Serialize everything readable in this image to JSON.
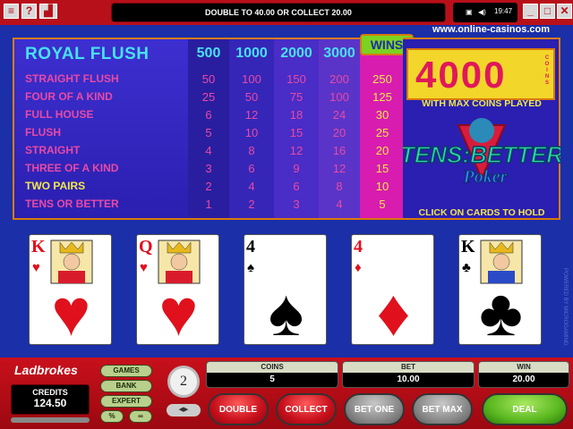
{
  "topbar": {
    "message": "DOUBLE TO 40.00 OR COLLECT 20.00",
    "clock": "19:47",
    "left_icons": [
      "menu-icon",
      "help-icon",
      "stats-icon"
    ],
    "right_icons": [
      "minimize-icon",
      "restore-icon",
      "close-icon"
    ]
  },
  "site": "www.online-casinos.com",
  "paytable": {
    "royal_label": "ROYAL FLUSH",
    "columns": [
      "500",
      "1000",
      "2000",
      "3000"
    ],
    "wins_label": "WINS",
    "rows": [
      {
        "hand": "STRAIGHT FLUSH",
        "values": [
          "50",
          "100",
          "150",
          "200",
          "250"
        ]
      },
      {
        "hand": "FOUR OF A KIND",
        "values": [
          "25",
          "50",
          "75",
          "100",
          "125"
        ]
      },
      {
        "hand": "FULL HOUSE",
        "values": [
          "6",
          "12",
          "18",
          "24",
          "30"
        ]
      },
      {
        "hand": "FLUSH",
        "values": [
          "5",
          "10",
          "15",
          "20",
          "25"
        ]
      },
      {
        "hand": "STRAIGHT",
        "values": [
          "4",
          "8",
          "12",
          "16",
          "20"
        ]
      },
      {
        "hand": "THREE OF A KIND",
        "values": [
          "3",
          "6",
          "9",
          "12",
          "15"
        ]
      },
      {
        "hand": "TWO PAIRS",
        "values": [
          "2",
          "4",
          "6",
          "8",
          "10"
        ]
      },
      {
        "hand": "TENS OR BETTER",
        "values": [
          "1",
          "2",
          "3",
          "4",
          "5"
        ]
      }
    ]
  },
  "right_panel": {
    "max_win": "4000",
    "coins_label": "COINS",
    "max_coins_text": "WITH MAX COINS PLAYED",
    "logo_line1": "TENS",
    "logo_line1b": "BETTER",
    "logo_line2": "Poker",
    "hold_text": "CLICK ON CARDS TO HOLD"
  },
  "cards": [
    {
      "rank": "K",
      "suit": "♥",
      "color": "red"
    },
    {
      "rank": "Q",
      "suit": "♥",
      "color": "red"
    },
    {
      "rank": "4",
      "suit": "♠",
      "color": "black"
    },
    {
      "rank": "4",
      "suit": "♦",
      "color": "red"
    },
    {
      "rank": "K",
      "suit": "♣",
      "color": "black"
    }
  ],
  "console": {
    "brand": "Ladbrokes",
    "credits_label": "CREDITS",
    "credits_value": "124.50",
    "pills": [
      "GAMES",
      "BANK",
      "EXPERT",
      "%",
      "∞"
    ],
    "coin_value": "2",
    "coins_label": "COINS",
    "coins_value": "5",
    "bet_label": "BET",
    "bet_value": "10.00",
    "win_label": "WIN",
    "win_value": "20.00",
    "buttons": {
      "double": "DOUBLE",
      "collect": "COLLECT",
      "bet_one": "BET ONE",
      "bet_max": "BET MAX",
      "deal": "DEAL"
    }
  }
}
